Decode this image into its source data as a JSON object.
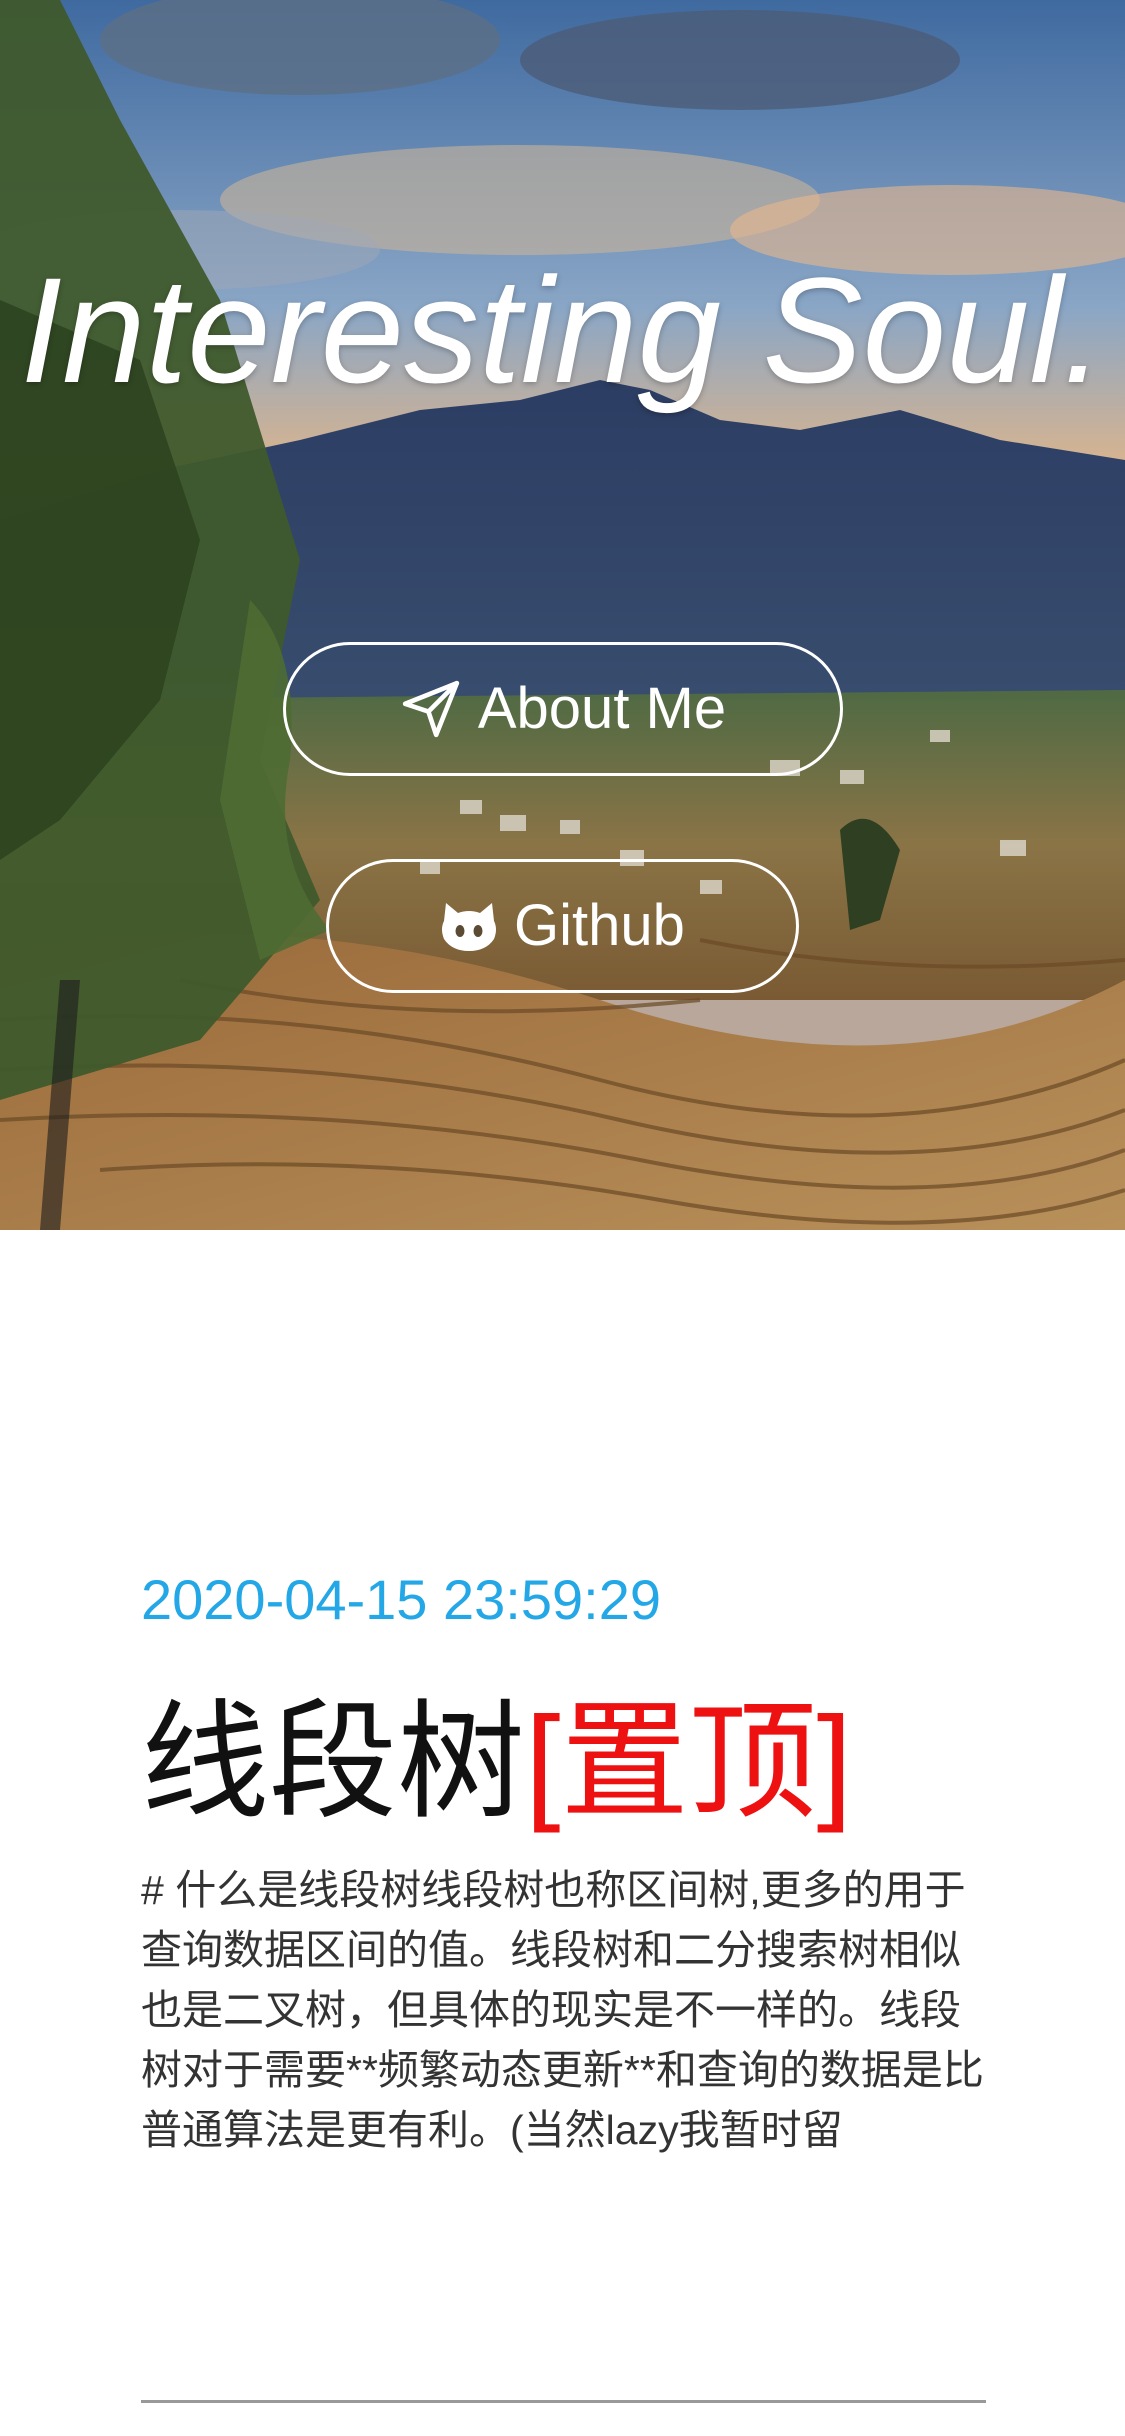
{
  "hero": {
    "title": "Interesting Soul.",
    "buttons": {
      "about_label": "About Me",
      "github_label": "Github"
    }
  },
  "post": {
    "date": "2020-04-15 23:59:29",
    "title": "线段树",
    "pinned_tag": "[置顶]",
    "excerpt": "# 什么是线段树线段树也称区间树,更多的用于查询数据区间的值。线段树和二分搜索树相似也是二叉树，但具体的现实是不一样的。线段树对于需要**频繁动态更新**和查询的数据是比普通算法是更有利。(当然lazy我暂时留"
  },
  "colors": {
    "date": "#23a7e6",
    "pinned": "#ee1111",
    "title": "#111111",
    "excerpt": "#333333"
  },
  "icons": {
    "about": "paper-plane-icon",
    "github": "github-cat-icon"
  }
}
